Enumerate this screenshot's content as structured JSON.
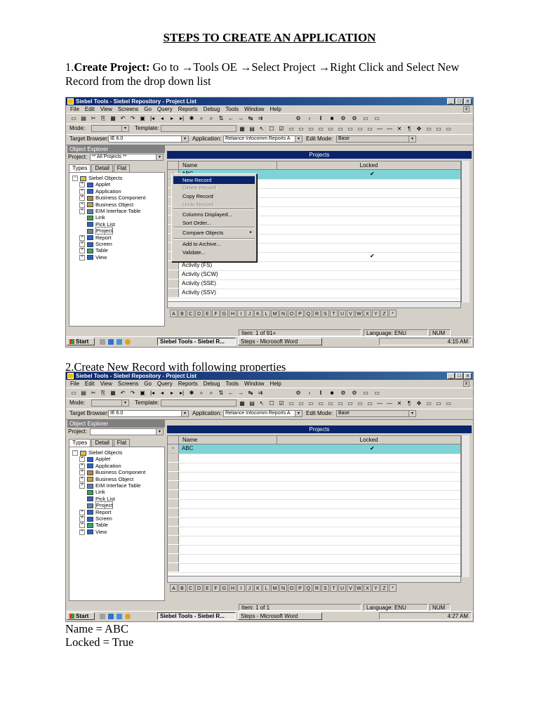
{
  "doc": {
    "title": "STEPS TO CREATE AN APPLICATION",
    "step1_num": "1.",
    "step1_bold": "Create Project:",
    "step1_text": " Go to →Tools OE →Select Project →Right Click and Select New Record from the drop down list",
    "step2": "2.Create New Record with following properties",
    "prop_name": "Name = ABC",
    "prop_locked": "Locked = True"
  },
  "window": {
    "title": "Siebel Tools - Siebel Repository - Project List",
    "controls": [
      "_",
      "□",
      "x"
    ],
    "menu": [
      "File",
      "Edit",
      "View",
      "Screens",
      "Go",
      "Query",
      "Reports",
      "Debug",
      "Tools",
      "Window",
      "Help"
    ],
    "mode_label": "Mode:",
    "template_label": "Template:",
    "target_browser_label": "Target Browser:",
    "target_browser_value": "IE 6.0",
    "application_label": "Application:",
    "application_value": "Reliance Infocomm Reports A",
    "edit_mode_label": "Edit Mode:",
    "edit_mode_value": "Base",
    "object_explorer": "Object Explorer",
    "project_label": "Project:",
    "project_value": "** All Projects **",
    "tabs": [
      "Types",
      "Detail",
      "Flat"
    ],
    "tree": [
      "Siebel Objects",
      "Applet",
      "Application",
      "Business Component",
      "Business Object",
      "EIM Interface Table",
      "Link",
      "Pick List",
      "Project",
      "Report",
      "Screen",
      "Table",
      "View"
    ],
    "projects_header": "Projects",
    "col_name": "Name",
    "col_locked": "Locked",
    "checkmark": "✔",
    "alphabet": [
      "A",
      "B",
      "C",
      "D",
      "E",
      "F",
      "G",
      "H",
      "I",
      "J",
      "K",
      "L",
      "M",
      "N",
      "O",
      "P",
      "Q",
      "R",
      "S",
      "T",
      "U",
      "V",
      "W",
      "X",
      "Y",
      "Z",
      "*"
    ],
    "language": "Language: ENU",
    "num": "NUM",
    "start": "Start",
    "task1": "Siebel Tools - Siebel R...",
    "task2": "Steps - Microsoft Word"
  },
  "shot1": {
    "rows": [
      "ABC",
      "",
      "",
      "",
      "",
      "",
      "",
      "",
      "",
      "",
      "Activity (FS)",
      "Activity (SCW)",
      "Activity (SSE)",
      "Activity (SSV)"
    ],
    "locked_rows": [
      0,
      9
    ],
    "item_count": "Item:  1 of 91+",
    "clock": "4:15 AM",
    "context_menu": [
      "New Record",
      "Delete Record",
      "Copy Record",
      "Undo Record",
      "Columns Displayed...",
      "Sort Order...",
      "Compare Objects",
      "Add to Archive...",
      "Validate..."
    ]
  },
  "shot2": {
    "rows": [
      "ABC"
    ],
    "item_count": "Item:  1 of 1",
    "clock": "4:27 AM"
  }
}
